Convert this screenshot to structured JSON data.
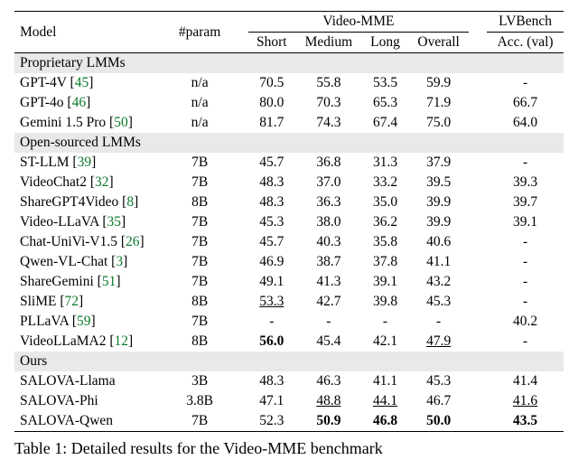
{
  "chart_data": {
    "type": "table",
    "title": "Table 1: Detailed results for the Video-MME benchmark",
    "columns": [
      "Model",
      "#param",
      "Video-MME Short",
      "Video-MME Medium",
      "Video-MME Long",
      "Video-MME Overall",
      "LVBench Acc. (val)"
    ],
    "groups": [
      {
        "name": "Proprietary LMMs",
        "rows": [
          {
            "model": "GPT-4V",
            "cite": "45",
            "param": "n/a",
            "short": 70.5,
            "medium": 55.8,
            "long": 53.5,
            "overall": 59.9,
            "lvbench": null
          },
          {
            "model": "GPT-4o",
            "cite": "46",
            "param": "n/a",
            "short": 80.0,
            "medium": 70.3,
            "long": 65.3,
            "overall": 71.9,
            "lvbench": 66.7
          },
          {
            "model": "Gemini 1.5 Pro",
            "cite": "50",
            "param": "n/a",
            "short": 81.7,
            "medium": 74.3,
            "long": 67.4,
            "overall": 75.0,
            "lvbench": 64.0
          }
        ]
      },
      {
        "name": "Open-sourced LMMs",
        "rows": [
          {
            "model": "ST-LLM",
            "cite": "39",
            "param": "7B",
            "short": 45.7,
            "medium": 36.8,
            "long": 31.3,
            "overall": 37.9,
            "lvbench": null
          },
          {
            "model": "VideoChat2",
            "cite": "32",
            "param": "7B",
            "short": 48.3,
            "medium": 37.0,
            "long": 33.2,
            "overall": 39.5,
            "lvbench": 39.3
          },
          {
            "model": "ShareGPT4Video",
            "cite": "8",
            "param": "8B",
            "short": 48.3,
            "medium": 36.3,
            "long": 35.0,
            "overall": 39.9,
            "lvbench": 39.7
          },
          {
            "model": "Video-LLaVA",
            "cite": "35",
            "param": "7B",
            "short": 45.3,
            "medium": 38.0,
            "long": 36.2,
            "overall": 39.9,
            "lvbench": 39.1
          },
          {
            "model": "Chat-UniVi-V1.5",
            "cite": "26",
            "param": "7B",
            "short": 45.7,
            "medium": 40.3,
            "long": 35.8,
            "overall": 40.6,
            "lvbench": null
          },
          {
            "model": "Qwen-VL-Chat",
            "cite": "3",
            "param": "7B",
            "short": 46.9,
            "medium": 38.7,
            "long": 37.8,
            "overall": 41.1,
            "lvbench": null
          },
          {
            "model": "ShareGemini",
            "cite": "51",
            "param": "7B",
            "short": 49.1,
            "medium": 41.3,
            "long": 39.1,
            "overall": 43.2,
            "lvbench": null
          },
          {
            "model": "SliME",
            "cite": "72",
            "param": "8B",
            "short": 53.3,
            "short_underline": true,
            "medium": 42.7,
            "long": 39.8,
            "overall": 45.3,
            "lvbench": null
          },
          {
            "model": "PLLaVA",
            "cite": "59",
            "param": "7B",
            "short": null,
            "medium": null,
            "long": null,
            "overall": null,
            "lvbench": 40.2
          },
          {
            "model": "VideoLLaMA2",
            "cite": "12",
            "param": "8B",
            "short": 56.0,
            "short_bold": true,
            "medium": 45.4,
            "long": 42.1,
            "overall": 47.9,
            "overall_underline": true,
            "lvbench": null
          }
        ]
      },
      {
        "name": "Ours",
        "rows": [
          {
            "model": "SALOVA-Llama",
            "param": "3B",
            "short": 48.3,
            "medium": 46.3,
            "long": 41.1,
            "overall": 45.3,
            "lvbench": 41.4
          },
          {
            "model": "SALOVA-Phi",
            "param": "3.8B",
            "short": 47.1,
            "medium": 48.8,
            "medium_underline": true,
            "long": 44.1,
            "long_underline": true,
            "overall": 46.7,
            "lvbench": 41.6,
            "lvbench_underline": true
          },
          {
            "model": "SALOVA-Qwen",
            "param": "7B",
            "short": 52.3,
            "medium": 50.9,
            "medium_bold": true,
            "long": 46.8,
            "long_bold": true,
            "overall": 50.0,
            "overall_bold": true,
            "lvbench": 43.5,
            "lvbench_bold": true
          }
        ]
      }
    ]
  },
  "headers": {
    "model": "Model",
    "param": "#param",
    "videomme": "Video-MME",
    "short": "Short",
    "medium": "Medium",
    "long": "Long",
    "overall": "Overall",
    "lvbench": "LVBench",
    "acc": "Acc. (val)"
  },
  "caption": "Table 1:  Detailed results for the Video-MME benchmark"
}
